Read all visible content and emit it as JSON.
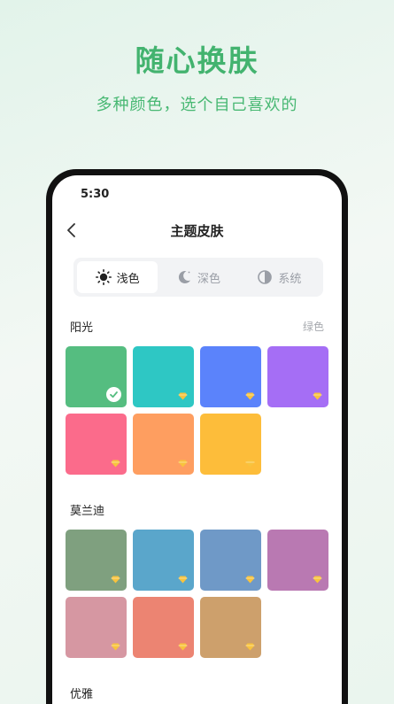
{
  "promo": {
    "headline": "随心换肤",
    "subline": "多种颜色，选个自己喜欢的"
  },
  "status_bar": {
    "time": "5:30"
  },
  "header": {
    "title": "主题皮肤",
    "back_icon": "chevron-left-icon"
  },
  "mode_tabs": [
    {
      "label": "浅色",
      "icon": "sun-icon",
      "selected": true
    },
    {
      "label": "深色",
      "icon": "moon-icon",
      "selected": false
    },
    {
      "label": "系统",
      "icon": "half-circle-icon",
      "selected": false
    }
  ],
  "sections": [
    {
      "title": "阳光",
      "current_label": "绿色",
      "tiles": [
        {
          "color": "#55bd80",
          "selected": true,
          "premium": false
        },
        {
          "color": "#2ec7c4",
          "selected": false,
          "premium": true
        },
        {
          "color": "#5b83fb",
          "selected": false,
          "premium": true
        },
        {
          "color": "#a56ef5",
          "selected": false,
          "premium": true
        },
        {
          "color": "#fb6b8b",
          "selected": false,
          "premium": true
        },
        {
          "color": "#fe9e60",
          "selected": false,
          "premium": true
        },
        {
          "color": "#fdbd3a",
          "selected": false,
          "premium": true
        }
      ]
    },
    {
      "title": "莫兰迪",
      "current_label": "",
      "tiles": [
        {
          "color": "#7fa07f",
          "selected": false,
          "premium": true
        },
        {
          "color": "#5aa6cb",
          "selected": false,
          "premium": true
        },
        {
          "color": "#6f99c7",
          "selected": false,
          "premium": true
        },
        {
          "color": "#b979b2",
          "selected": false,
          "premium": true
        },
        {
          "color": "#d697a2",
          "selected": false,
          "premium": true
        },
        {
          "color": "#ec8472",
          "selected": false,
          "premium": true
        },
        {
          "color": "#cda06c",
          "selected": false,
          "premium": true
        }
      ]
    },
    {
      "title": "优雅",
      "current_label": "",
      "tiles": []
    }
  ],
  "colors": {
    "accent": "#43b36f",
    "gem": "#f8c33d"
  }
}
